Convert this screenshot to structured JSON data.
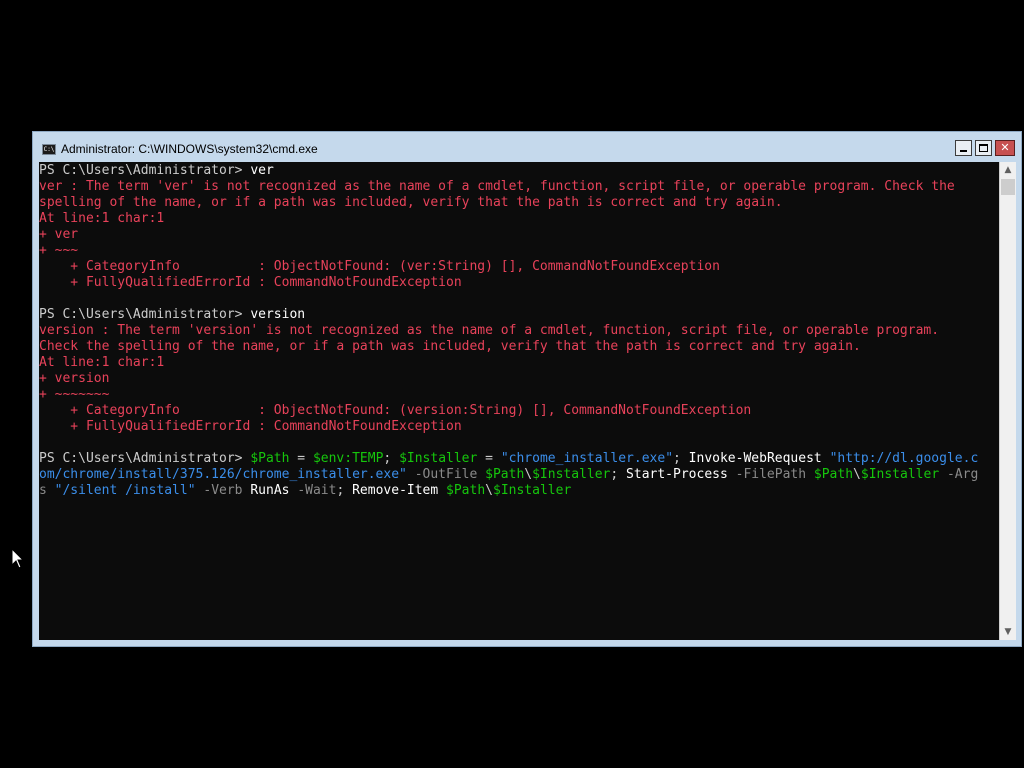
{
  "window": {
    "title": "Administrator: C:\\WINDOWS\\system32\\cmd.exe",
    "icon_text": "C:\\",
    "icon": "console-app-icon"
  },
  "controls": {
    "minimize": "minimize-icon",
    "maximize": "maximize-icon",
    "close": "close-icon",
    "close_glyph": "✕"
  },
  "scrollbar": {
    "up_arrow": "▲",
    "down_arrow": "▼"
  },
  "colors": {
    "background": "#0c0c0c",
    "error": "#e8425a",
    "variable": "#16c60c",
    "string": "#3b8eea",
    "parameter": "#8a8a8a"
  },
  "console": {
    "lines": [
      [
        {
          "t": "PS C:\\Users\\Administrator> ",
          "c": "prompt"
        },
        {
          "t": "ver",
          "c": "cmd"
        }
      ],
      [
        {
          "t": "ver : The term 'ver' is not recognized as the name of a cmdlet, function, script file, or operable program. Check the",
          "c": "err"
        }
      ],
      [
        {
          "t": "spelling of the name, or if a path was included, verify that the path is correct and try again.",
          "c": "err"
        }
      ],
      [
        {
          "t": "At line:1 char:1",
          "c": "err"
        }
      ],
      [
        {
          "t": "+ ver",
          "c": "err"
        }
      ],
      [
        {
          "t": "+ ~~~",
          "c": "err"
        }
      ],
      [
        {
          "t": "    + CategoryInfo          : ObjectNotFound: (ver:String) [], CommandNotFoundException",
          "c": "err"
        }
      ],
      [
        {
          "t": "    + FullyQualifiedErrorId : CommandNotFoundException",
          "c": "err"
        }
      ],
      [
        {
          "t": " ",
          "c": "plain"
        }
      ],
      [
        {
          "t": "PS C:\\Users\\Administrator> ",
          "c": "prompt"
        },
        {
          "t": "version",
          "c": "cmd"
        }
      ],
      [
        {
          "t": "version : The term 'version' is not recognized as the name of a cmdlet, function, script file, or operable program.",
          "c": "err"
        }
      ],
      [
        {
          "t": "Check the spelling of the name, or if a path was included, verify that the path is correct and try again.",
          "c": "err"
        }
      ],
      [
        {
          "t": "At line:1 char:1",
          "c": "err"
        }
      ],
      [
        {
          "t": "+ version",
          "c": "err"
        }
      ],
      [
        {
          "t": "+ ~~~~~~~",
          "c": "err"
        }
      ],
      [
        {
          "t": "    + CategoryInfo          : ObjectNotFound: (version:String) [], CommandNotFoundException",
          "c": "err"
        }
      ],
      [
        {
          "t": "    + FullyQualifiedErrorId : CommandNotFoundException",
          "c": "err"
        }
      ],
      [
        {
          "t": " ",
          "c": "plain"
        }
      ],
      [
        {
          "t": "PS C:\\Users\\Administrator> ",
          "c": "prompt"
        },
        {
          "t": "$Path",
          "c": "var"
        },
        {
          "t": " = ",
          "c": "plain"
        },
        {
          "t": "$env:TEMP",
          "c": "var"
        },
        {
          "t": "; ",
          "c": "plain"
        },
        {
          "t": "$Installer",
          "c": "var"
        },
        {
          "t": " = ",
          "c": "plain"
        },
        {
          "t": "\"chrome_installer.exe\"",
          "c": "str"
        },
        {
          "t": "; ",
          "c": "plain"
        },
        {
          "t": "Invoke-WebRequest",
          "c": "cmd"
        },
        {
          "t": " ",
          "c": "plain"
        },
        {
          "t": "\"http://dl.google.c",
          "c": "str"
        }
      ],
      [
        {
          "t": "om/chrome/install/375.126/chrome_installer.exe\"",
          "c": "str"
        },
        {
          "t": " ",
          "c": "plain"
        },
        {
          "t": "-OutFile",
          "c": "param"
        },
        {
          "t": " ",
          "c": "plain"
        },
        {
          "t": "$Path",
          "c": "var"
        },
        {
          "t": "\\",
          "c": "plain"
        },
        {
          "t": "$Installer",
          "c": "var"
        },
        {
          "t": "; ",
          "c": "plain"
        },
        {
          "t": "Start-Process",
          "c": "cmd"
        },
        {
          "t": " ",
          "c": "plain"
        },
        {
          "t": "-FilePath",
          "c": "param"
        },
        {
          "t": " ",
          "c": "plain"
        },
        {
          "t": "$Path",
          "c": "var"
        },
        {
          "t": "\\",
          "c": "plain"
        },
        {
          "t": "$Installer",
          "c": "var"
        },
        {
          "t": " ",
          "c": "plain"
        },
        {
          "t": "-Arg",
          "c": "param"
        }
      ],
      [
        {
          "t": "s",
          "c": "param"
        },
        {
          "t": " ",
          "c": "plain"
        },
        {
          "t": "\"/silent /install\"",
          "c": "str"
        },
        {
          "t": " ",
          "c": "plain"
        },
        {
          "t": "-Verb",
          "c": "param"
        },
        {
          "t": " ",
          "c": "plain"
        },
        {
          "t": "RunAs",
          "c": "cmd"
        },
        {
          "t": " ",
          "c": "plain"
        },
        {
          "t": "-Wait",
          "c": "param"
        },
        {
          "t": "; ",
          "c": "plain"
        },
        {
          "t": "Remove-Item",
          "c": "cmd"
        },
        {
          "t": " ",
          "c": "plain"
        },
        {
          "t": "$Path",
          "c": "var"
        },
        {
          "t": "\\",
          "c": "plain"
        },
        {
          "t": "$Installer",
          "c": "var"
        }
      ]
    ]
  },
  "pointer": {
    "icon": "mouse-pointer-icon"
  }
}
